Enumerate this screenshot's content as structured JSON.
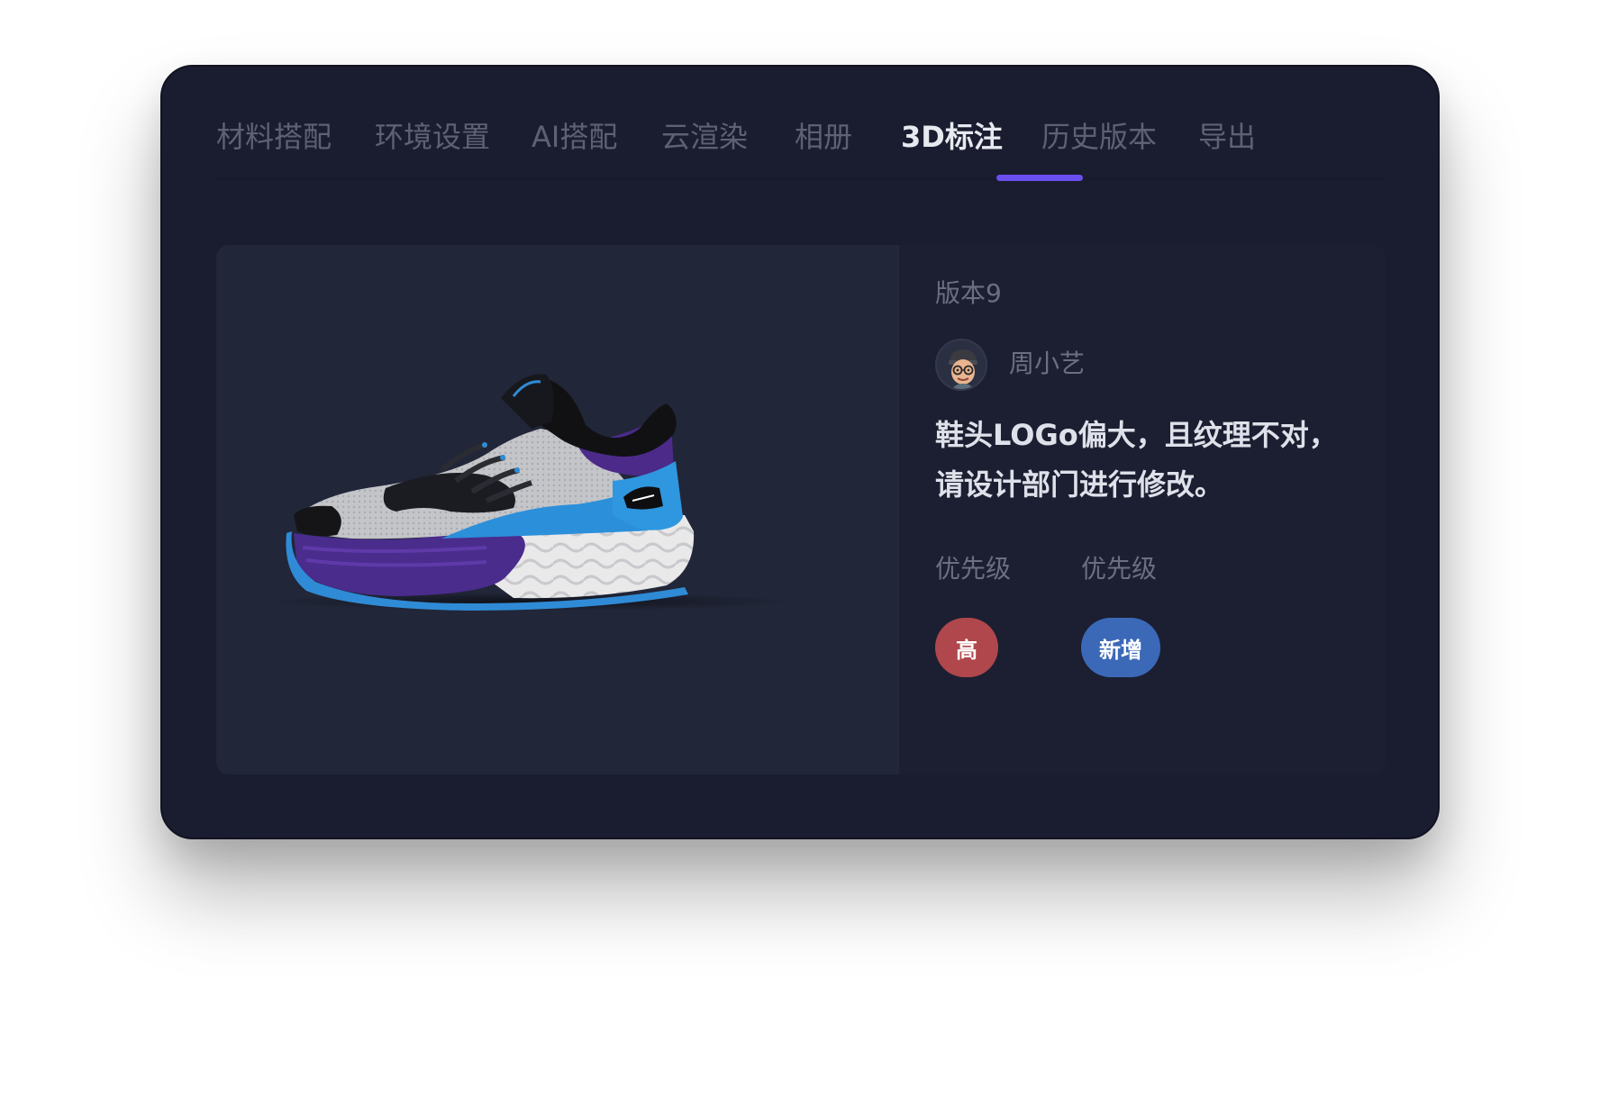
{
  "tabs": [
    {
      "label": "材料搭配",
      "active": false
    },
    {
      "label": "环境设置",
      "active": false
    },
    {
      "label": "AI搭配",
      "active": false
    },
    {
      "label": "云渲染",
      "active": false
    },
    {
      "label": "相册",
      "active": false
    },
    {
      "label": "3D标注",
      "active": true
    },
    {
      "label": "历史版本",
      "active": false
    },
    {
      "label": "导出",
      "active": false
    }
  ],
  "annotation": {
    "version": "版本9",
    "author": "周小艺",
    "comment_line1": "鞋头LOGo偏大，且纹理不对，",
    "comment_line2": "请设计部门进行修改。",
    "priority_label": "优先级",
    "priority_value": "高",
    "type_label": "优先级",
    "type_value": "新增"
  },
  "colors": {
    "window_bg": "#1a1d2f",
    "accent": "#6b4ef0",
    "priority_badge": "#b0474c",
    "type_badge": "#3b69b8"
  },
  "icons": {
    "avatar": "memoji-avatar",
    "model": "sneaker-3d-model"
  }
}
